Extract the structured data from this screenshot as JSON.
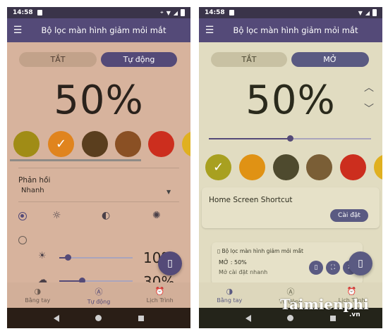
{
  "status": {
    "time": "14:58"
  },
  "app": {
    "title": "Bộ lọc màn hình giảm mỏi mắt"
  },
  "left": {
    "toggle": {
      "off_label": "TẮT",
      "on_label": "Tự động"
    },
    "intensity_label": "50%",
    "swatches": [
      {
        "color": "#a08c16",
        "selected": false
      },
      {
        "color": "#e0841e",
        "selected": true
      },
      {
        "color": "#5a3e1e",
        "selected": false
      },
      {
        "color": "#8a5024",
        "selected": false
      },
      {
        "color": "#cc2e1e",
        "selected": false
      }
    ],
    "feedback": {
      "label": "Phản hồi",
      "value": "Nhanh"
    },
    "row1_pct": "10%",
    "row2_pct": "30%"
  },
  "right": {
    "toggle": {
      "off_label": "TẮT",
      "on_label": "MỞ"
    },
    "intensity_label": "50%",
    "intensity_value": 0.5,
    "swatches": [
      {
        "color": "#a8a020",
        "selected": true
      },
      {
        "color": "#e09214",
        "selected": false
      },
      {
        "color": "#4e4a2e",
        "selected": false
      },
      {
        "color": "#7a5e36",
        "selected": false
      },
      {
        "color": "#cc2e1e",
        "selected": false
      }
    ],
    "shortcut_card": {
      "title": "Home Screen Shortcut",
      "button": "Cài đặt"
    },
    "notification": {
      "title": "Bộ lọc màn hình giảm mỏi mắt",
      "line1": "MỞ : 50%",
      "line2": "Mở cài đặt nhanh"
    }
  },
  "nav": {
    "items": [
      "Bằng tay",
      "Tự động",
      "Lịch Trình"
    ],
    "active_left": 1,
    "active_right": 0
  },
  "watermark": {
    "text": "Taimienphi",
    "suffix": ".vn"
  },
  "colors": {
    "primary": "#544a78",
    "left_bg": "#d7b39d",
    "right_bg": "#e1dcc1"
  }
}
